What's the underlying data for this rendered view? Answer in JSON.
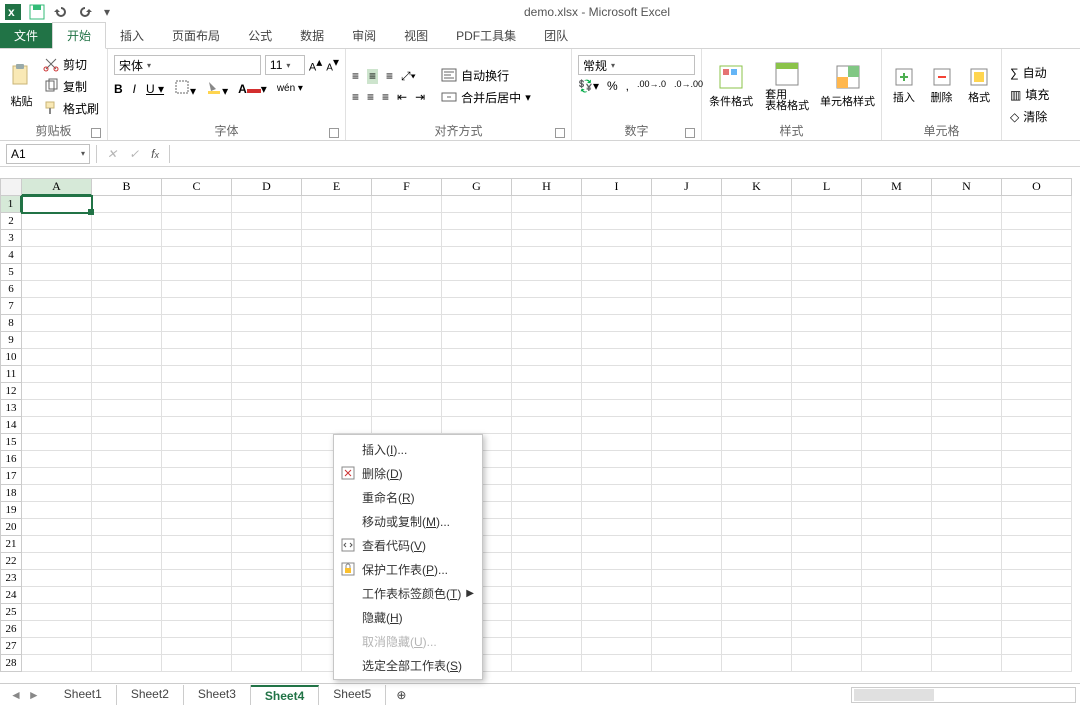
{
  "title": "demo.xlsx - Microsoft Excel",
  "tabs": [
    "文件",
    "开始",
    "插入",
    "页面布局",
    "公式",
    "数据",
    "审阅",
    "视图",
    "PDF工具集",
    "团队"
  ],
  "active_tab_index": 1,
  "clipboard_group": {
    "paste": "粘贴",
    "cut": "剪切",
    "copy": "复制",
    "format_painter": "格式刷",
    "label": "剪贴板"
  },
  "font_group": {
    "name": "宋体",
    "size": "11",
    "label": "字体"
  },
  "align_group": {
    "wrap": "自动换行",
    "merge": "合并后居中",
    "label": "对齐方式"
  },
  "number_group": {
    "format": "常规",
    "label": "数字"
  },
  "styles_group": {
    "cond": "条件格式",
    "table": "套用\n表格格式",
    "cell": "单元格样式",
    "label": "样式"
  },
  "cells_group": {
    "insert": "插入",
    "delete": "删除",
    "format": "格式",
    "label": "单元格"
  },
  "editing_group": {
    "sum": "自动",
    "fill": "填充",
    "clear": "清除"
  },
  "name_box": "A1",
  "columns": [
    "A",
    "B",
    "C",
    "D",
    "E",
    "F",
    "G",
    "H",
    "I",
    "J",
    "K",
    "L",
    "M",
    "N",
    "O"
  ],
  "row_count": 28,
  "active_cell": {
    "row": 1,
    "col": "A"
  },
  "sheets": [
    "Sheet1",
    "Sheet2",
    "Sheet3",
    "Sheet4",
    "Sheet5"
  ],
  "active_sheet_index": 3,
  "context_menu": [
    {
      "label": "插入(",
      "accel": "I",
      "suffix": ")...",
      "icon": null
    },
    {
      "label": "删除(",
      "accel": "D",
      "suffix": ")",
      "icon": "delete-sheet"
    },
    {
      "label": "重命名(",
      "accel": "R",
      "suffix": ")",
      "icon": null
    },
    {
      "label": "移动或复制(",
      "accel": "M",
      "suffix": ")...",
      "icon": null
    },
    {
      "label": "查看代码(",
      "accel": "V",
      "suffix": ")",
      "icon": "view-code"
    },
    {
      "label": "保护工作表(",
      "accel": "P",
      "suffix": ")...",
      "icon": "protect"
    },
    {
      "label": "工作表标签颜色(",
      "accel": "T",
      "suffix": ")",
      "icon": null,
      "sub": true
    },
    {
      "label": "隐藏(",
      "accel": "H",
      "suffix": ")",
      "icon": null
    },
    {
      "label": "取消隐藏(",
      "accel": "U",
      "suffix": ")...",
      "icon": null,
      "disabled": true
    },
    {
      "label": "选定全部工作表(",
      "accel": "S",
      "suffix": ")",
      "icon": null
    }
  ]
}
